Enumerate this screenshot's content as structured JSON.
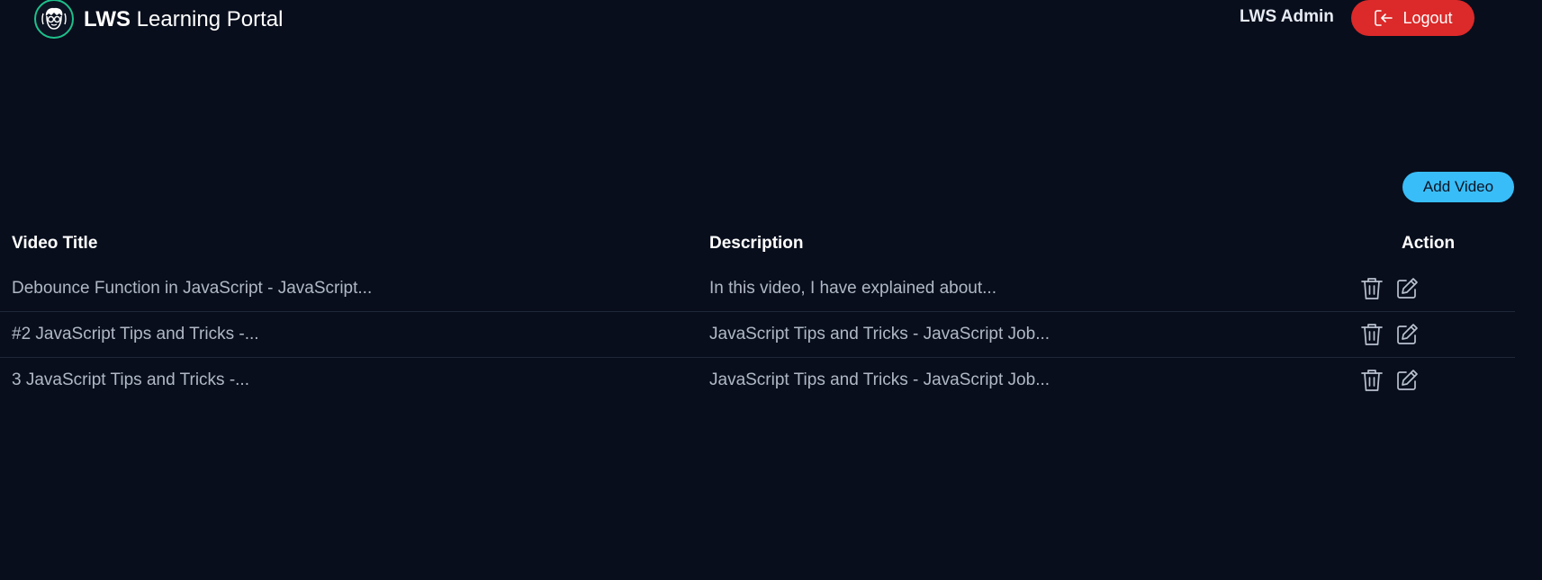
{
  "header": {
    "brand_strong": "LWS",
    "brand_rest": " Learning Portal",
    "admin_name": "LWS Admin",
    "logout_label": "Logout",
    "logo_icon": "developer-avatar-icon",
    "logout_icon": "logout-icon"
  },
  "toolbar": {
    "add_video_label": "Add Video"
  },
  "table": {
    "columns": [
      "Video Title",
      "Description",
      "Action"
    ],
    "rows": [
      {
        "title": "Debounce Function in JavaScript - JavaScript...",
        "description": "In this video, I have explained about..."
      },
      {
        "title": "#2 JavaScript Tips and Tricks -...",
        "description": "JavaScript Tips and Tricks - JavaScript Job..."
      },
      {
        "title": "3 JavaScript Tips and Tricks -...",
        "description": "JavaScript Tips and Tricks - JavaScript Job..."
      }
    ],
    "action_icons": [
      "trash-icon",
      "edit-icon"
    ]
  },
  "colors": {
    "background": "#080e1c",
    "logout": "#dc2929",
    "add_video": "#38bdf8",
    "logo_ring": "#1ec08b"
  }
}
